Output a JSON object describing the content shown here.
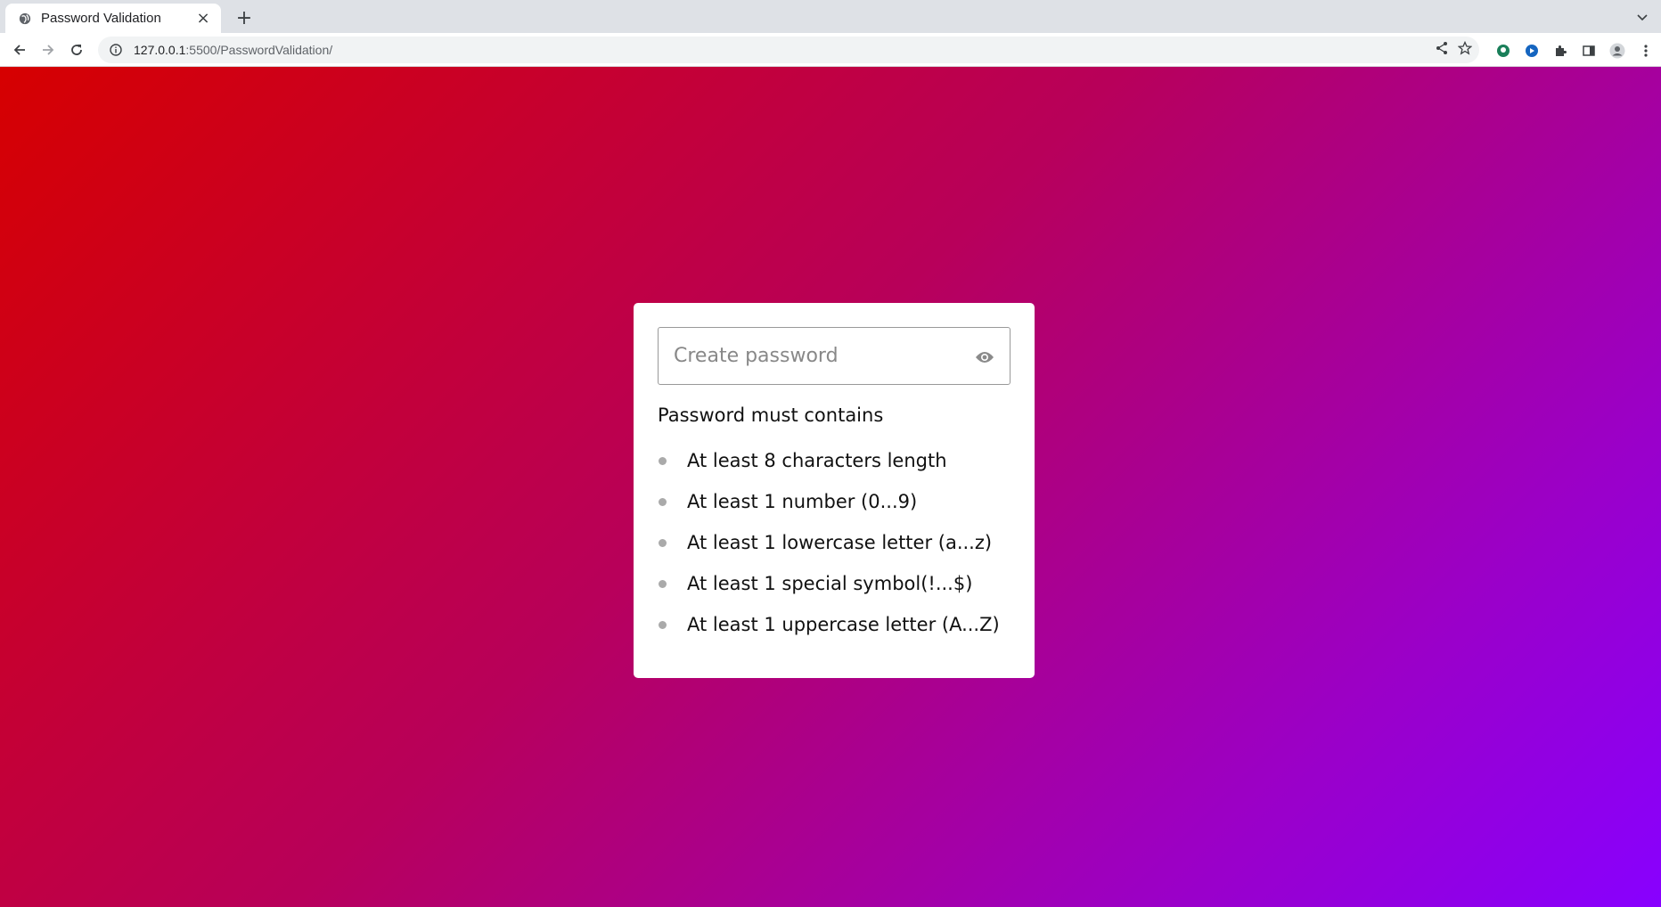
{
  "browser": {
    "tab_title": "Password Validation",
    "url_host": "127.0.0.1",
    "url_rest": ":5500/PasswordValidation/"
  },
  "page": {
    "password_placeholder": "Create password",
    "requirements_title": "Password must contains",
    "requirements": [
      "At least 8 characters length",
      "At least 1 number (0...9)",
      "At least 1 lowercase letter (a...z)",
      "At least 1 special symbol(!...$)",
      "At least 1 uppercase letter (A...Z)"
    ],
    "colors": {
      "gradient_start": "#d60000",
      "gradient_end": "#8800ff",
      "bullet": "#aaaaaa"
    }
  }
}
